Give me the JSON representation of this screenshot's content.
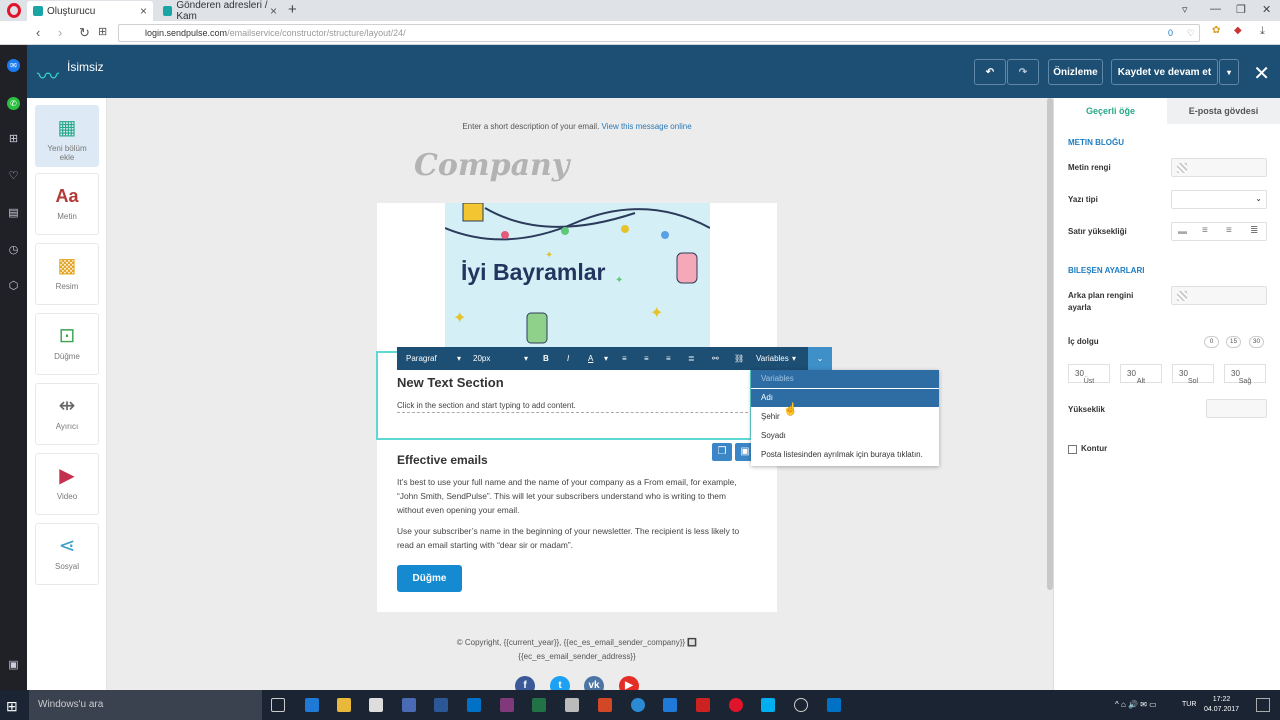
{
  "browser": {
    "tabs": [
      {
        "label": "Oluşturucu"
      },
      {
        "label": "Gönderen adresleri / Kam"
      }
    ],
    "url_domain": "login.sendpulse.com",
    "url_path": "/emailservice/constructor/structure/layout/24/",
    "url_badge": "0"
  },
  "header": {
    "app_name": "İsimsiz",
    "preview_label": "Önizleme",
    "save_label": "Kaydet ve devam et"
  },
  "tools": [
    {
      "label": "Yeni bölüm ekle",
      "icon": "grid-icon"
    },
    {
      "label": "Metin",
      "icon": "text-icon"
    },
    {
      "label": "Resim",
      "icon": "image-icon"
    },
    {
      "label": "Düğme",
      "icon": "button-icon"
    },
    {
      "label": "Ayırıcı",
      "icon": "divider-icon"
    },
    {
      "label": "Video",
      "icon": "video-icon"
    },
    {
      "label": "Sosyal",
      "icon": "share-icon"
    }
  ],
  "email": {
    "description": "Enter a short description of your email.",
    "view_online": "View this message online",
    "company": "Company",
    "banner_text": "İyi Bayramlar",
    "section_title": "New Text Section",
    "section_sub": "Click in the section and start typing to add content.",
    "effective_title": "Effective emails",
    "para1": "It’s best to use your full name and the name of your company as a From email, for example, “John Smith, SendPulse”. This will let your subscribers understand who is writing to them without even opening your email.",
    "para2": "Use your subscriber’s name in the beginning of your newsletter. The recipient is less likely to read an email starting with “dear sir or madam”.",
    "button_label": "Düğme",
    "footer": "© Copyright, {{current_year}}, {{ec_es_email_sender_company}} 🔲 {{ec_es_email_sender_address}}"
  },
  "richbar": {
    "style": "Paragraf",
    "size": "20px",
    "variables": "Variables"
  },
  "dropdown": {
    "items": [
      "Variables",
      "Adı",
      "Şehir",
      "Soyadı",
      "Posta listesinden ayrılmak için buraya tıklatın."
    ],
    "selected": "Adı"
  },
  "right_panel": {
    "tabs": [
      "Geçerli öğe",
      "E-posta gövdesi"
    ],
    "section1": "METIN BLOĞU",
    "text_color": "Metin rengi",
    "font": "Yazı tipi",
    "line_height": "Satır yüksekliği",
    "section2": "BILEŞEN AYARLARI",
    "bg_color": "Arka plan rengini ayarla",
    "padding_label": "İç dolgu",
    "padding_presets": [
      "0",
      "15",
      "30"
    ],
    "padding_values": [
      "30",
      "30",
      "30",
      "30"
    ],
    "padding_sides": [
      "Üst",
      "Alt",
      "Sol",
      "Sağ"
    ],
    "height": "Yükseklik",
    "border": "Kontur"
  },
  "taskbar": {
    "search": "Windows'u ara",
    "lang": "TUR",
    "time": "17:22",
    "date": "04.07.2017"
  },
  "colors": {
    "header": "#1d4e73",
    "accent": "#168ad0",
    "selection": "#5ed8d3"
  }
}
